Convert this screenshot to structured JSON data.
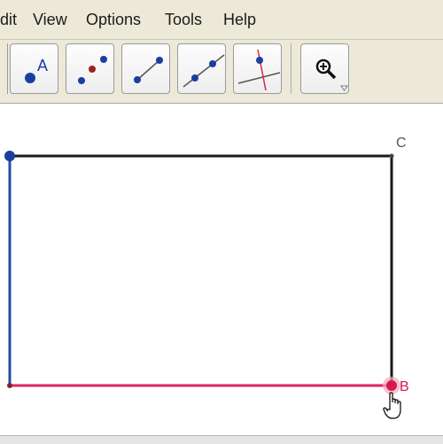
{
  "menu": {
    "items": [
      "dit",
      "View",
      "Options",
      "Tools",
      "Help"
    ]
  },
  "toolbar": {
    "tools": [
      {
        "icon": "new-point-icon"
      },
      {
        "icon": "point-on-object-icon"
      },
      {
        "icon": "segment-icon"
      },
      {
        "icon": "line-through-two-points-icon"
      },
      {
        "icon": "perpendicular-line-icon"
      },
      {
        "icon": "zoom-in-icon"
      }
    ]
  },
  "canvas": {
    "labels": {
      "point_a_tool": "A",
      "point_c": "C",
      "point_b": "B"
    },
    "colors": {
      "segment_blue": "#1f4fa0",
      "segment_red": "#e0245e",
      "segment_black": "#1a1a1a",
      "point_blue": "#1a3f9e",
      "point_red": "#d61a4a"
    }
  }
}
